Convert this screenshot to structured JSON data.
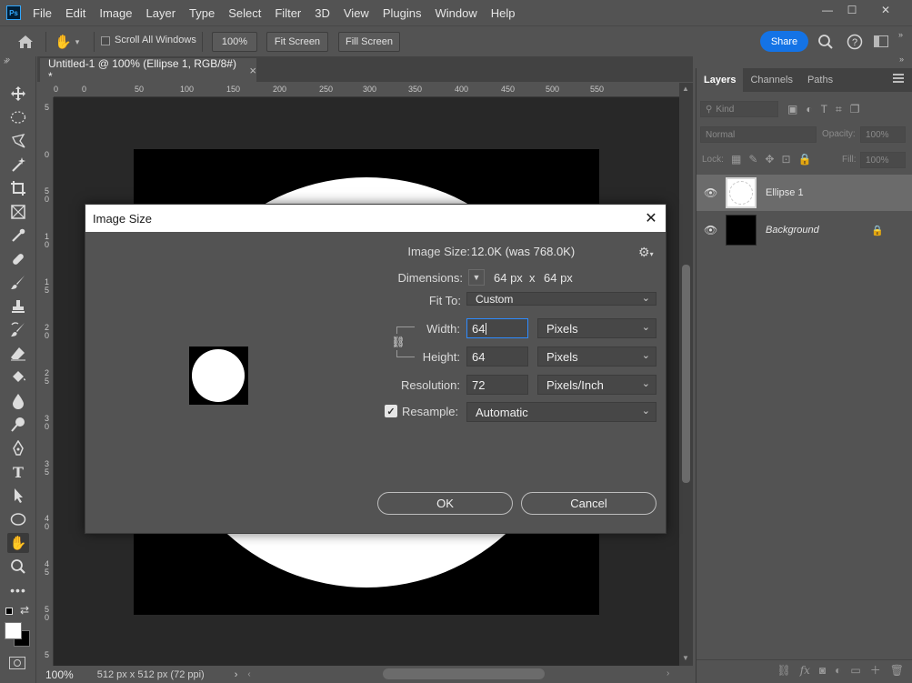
{
  "app": {
    "logo": "Ps"
  },
  "menu": [
    "File",
    "Edit",
    "Image",
    "Layer",
    "Type",
    "Select",
    "Filter",
    "3D",
    "View",
    "Plugins",
    "Window",
    "Help"
  ],
  "window_controls": {
    "minimize": "—",
    "maximize": "☐",
    "close": "✕"
  },
  "options": {
    "scroll_all_windows": "Scroll All Windows",
    "zoom": "100%",
    "fit_screen": "Fit Screen",
    "fill_screen": "Fill Screen",
    "share": "Share"
  },
  "document": {
    "tab_title": "Untitled-1 @ 100% (Ellipse 1, RGB/8#) *",
    "tab_close": "×",
    "status_zoom": "100%",
    "status_info": "512 px x 512 px (72 ppi)",
    "ruler_h": [
      "0",
      "0",
      "50",
      "100",
      "150",
      "200",
      "250",
      "300",
      "350",
      "400",
      "450",
      "500",
      "550"
    ],
    "ruler_v": [
      "5",
      "0",
      "5",
      "0",
      "1",
      "0",
      "1",
      "5",
      "2",
      "0",
      "2",
      "5",
      "3",
      "0",
      "3",
      "5",
      "4",
      "0",
      "4",
      "5",
      "5",
      "0",
      "5"
    ]
  },
  "panel": {
    "tabs": [
      "Layers",
      "Channels",
      "Paths"
    ],
    "kind_label": "Kind",
    "blend_mode": "Normal",
    "opacity_label": "Opacity:",
    "opacity_value": "100%",
    "lock_label": "Lock:",
    "fill_label": "Fill:",
    "fill_value": "100%",
    "layers": [
      {
        "name": "Ellipse 1"
      },
      {
        "name": "Background"
      }
    ],
    "bottom_icons": [
      "⛓",
      "fx",
      "◙",
      "◐",
      "▭",
      "＋",
      "🗑"
    ]
  },
  "dialog": {
    "title": "Image Size",
    "image_size_label": "Image Size:",
    "image_size_value": "12.0K (was 768.0K)",
    "dimensions_label": "Dimensions:",
    "dimensions_w": "64 px",
    "dimensions_x": "x",
    "dimensions_h": "64 px",
    "fit_to_label": "Fit To:",
    "fit_to_value": "Custom",
    "width_label": "Width:",
    "width_value": "64",
    "width_unit": "Pixels",
    "height_label": "Height:",
    "height_value": "64",
    "height_unit": "Pixels",
    "resolution_label": "Resolution:",
    "resolution_value": "72",
    "resolution_unit": "Pixels/Inch",
    "resample_label": "Resample:",
    "resample_checked": true,
    "resample_value": "Automatic",
    "ok_label": "OK",
    "cancel_label": "Cancel"
  },
  "colors": {
    "accent": "#1473e6",
    "focus": "#2e8bff",
    "chrome": "#535353",
    "canvas_bg": "#282828"
  }
}
